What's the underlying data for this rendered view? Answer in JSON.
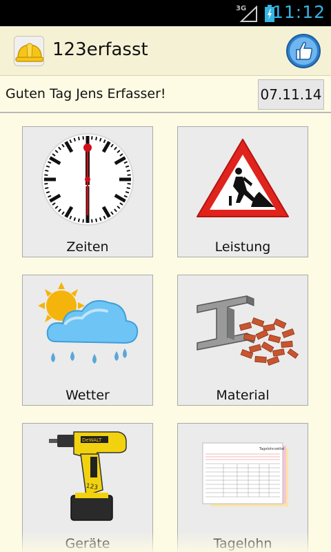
{
  "status_bar": {
    "network": "3G",
    "time": "11:12"
  },
  "action_bar": {
    "title": "123erfasst",
    "app_icon": "hard-hat-icon",
    "action_icon": "thumbs-up-icon"
  },
  "greeting": {
    "text": "Guten Tag Jens Erfasser!",
    "date": "07.11.14"
  },
  "tiles": [
    {
      "label": "Zeiten",
      "icon": "clock-icon"
    },
    {
      "label": "Leistung",
      "icon": "roadwork-sign-icon"
    },
    {
      "label": "Wetter",
      "icon": "weather-rain-icon"
    },
    {
      "label": "Material",
      "icon": "bricks-steel-icon"
    },
    {
      "label": "Geräte",
      "icon": "drill-icon"
    },
    {
      "label": "Tagelohn",
      "icon": "form-document-icon"
    }
  ]
}
